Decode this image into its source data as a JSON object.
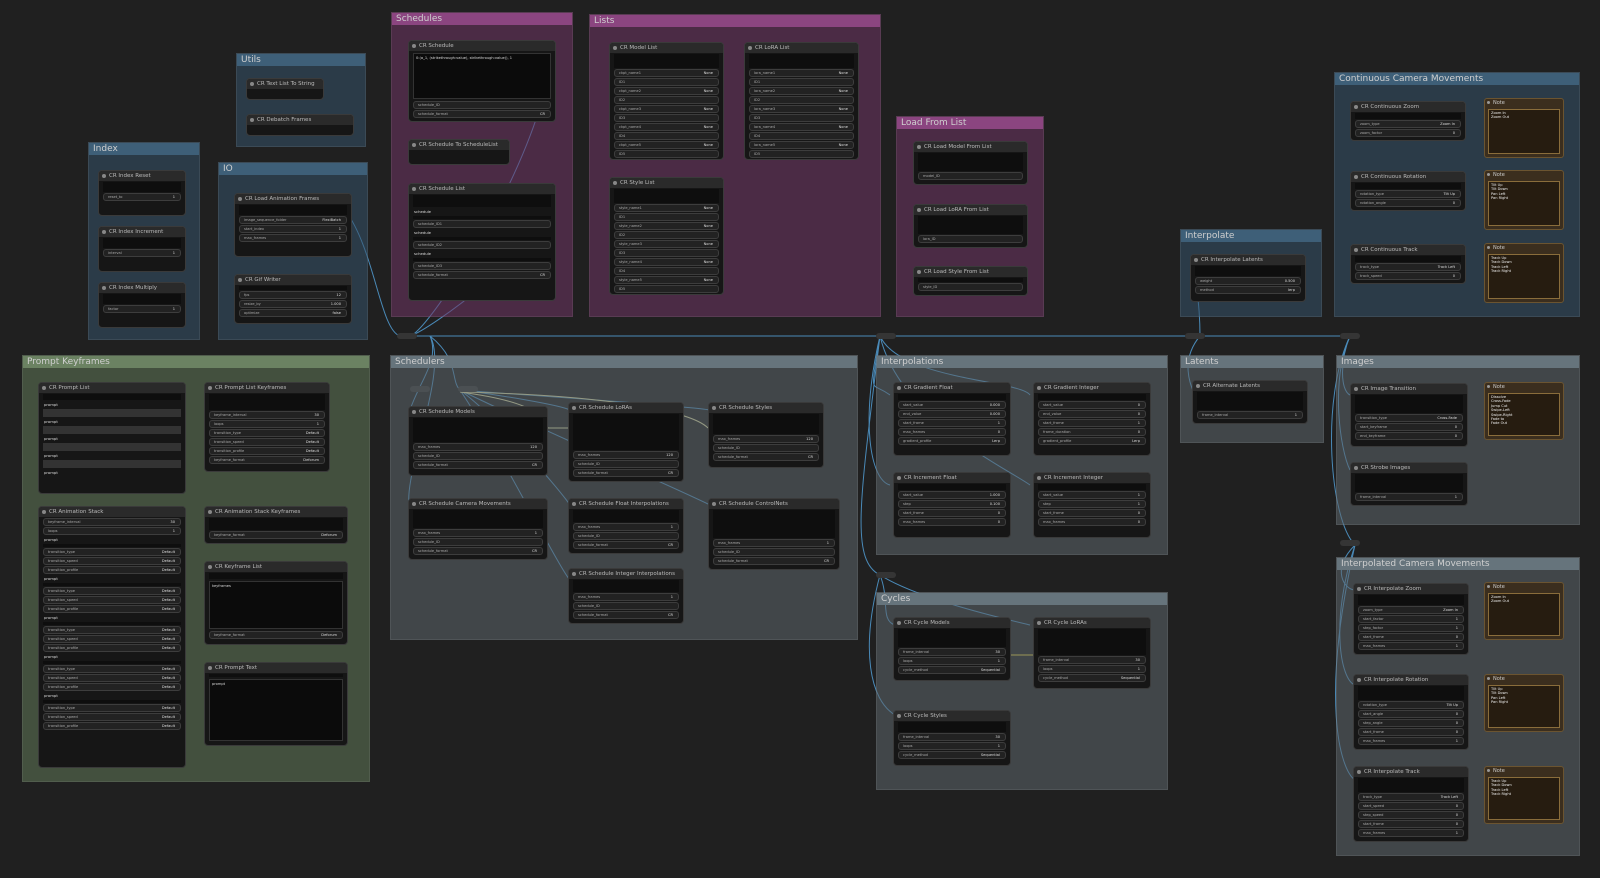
{
  "colors": {
    "canvas": "#202020",
    "purple": "#8b4580",
    "blue": "#3e5f78",
    "green": "#6b8262",
    "gray": "#66747c",
    "wire": "#4a8ab8"
  },
  "groups": {
    "index": "Index",
    "utils": "Utils",
    "io": "IO",
    "schedules": "Schedules",
    "lists": "Lists",
    "load_from_list": "Load From List",
    "interpolate": "Interpolate",
    "continuous": "Continuous Camera Movements",
    "prompt_keyframes": "Prompt Keyframes",
    "schedulers": "Schedulers",
    "interpolations": "Interpolations",
    "latents": "Latents",
    "images": "Images",
    "cycles": "Cycles",
    "interp_camera": "Interpolated Camera Movements"
  },
  "nodes": {
    "index_reset": {
      "title": "CR Index Reset",
      "w1": "reset_to",
      "v1": "1"
    },
    "index_increment": {
      "title": "CR Index Increment",
      "w1": "interval",
      "v1": "1"
    },
    "index_multiply": {
      "title": "CR Index Multiply",
      "w1": "factor",
      "v1": "1"
    },
    "text_list_to_string": {
      "title": "CR Text List To String"
    },
    "debatch_frames": {
      "title": "CR Debatch Frames"
    },
    "load_anim_frames": {
      "title": "CR Load Animation Frames",
      "w1": "image_sequence_folder",
      "v1": "FlexiBatch",
      "w2": "start_index",
      "v2": "1",
      "w3": "max_frames",
      "v3": "1"
    },
    "gif_writer": {
      "title": "CR Gif Writer",
      "w1": "fps",
      "v1": "12",
      "w2": "resize_by",
      "v2": "1.000",
      "w3": "optimize",
      "v3": "false"
    },
    "schedule": {
      "title": "CR Schedule",
      "text": "0:(a_1, (strikethrough:value), strikethrough:value)), 1",
      "w1": "schedule_ID",
      "w2": "schedule_format",
      "v2": "CR"
    },
    "schedule_to_list": {
      "title": "CR Schedule To ScheduleList"
    },
    "schedule_list": {
      "title": "CR Schedule List",
      "l1": "schedule",
      "w1": "schedule_ID1",
      "l2": "schedule",
      "w2": "schedule_ID2",
      "l3": "schedule",
      "w3": "schedule_ID3",
      "w4": "schedule_format",
      "v4": "CR"
    },
    "model_list": {
      "title": "CR Model List",
      "w1": "ckpt_name1",
      "w2": "ID1",
      "w3": "ckpt_name2",
      "w4": "ID2",
      "w5": "ckpt_name3",
      "w6": "ID3",
      "w7": "ckpt_name4",
      "w8": "ID4",
      "w9": "ckpt_name5",
      "w10": "ID5",
      "none": "None"
    },
    "lora_list": {
      "title": "CR LoRA List",
      "w1": "lora_name1",
      "w2": "ID1",
      "w3": "lora_name2",
      "w4": "ID2",
      "w5": "lora_name3",
      "w6": "ID3",
      "w7": "lora_name4",
      "w8": "ID4",
      "w9": "lora_name5",
      "w10": "ID5",
      "none": "None"
    },
    "style_list": {
      "title": "CR Style List",
      "w1": "style_name1",
      "w2": "ID1",
      "w3": "style_name2",
      "w4": "ID2",
      "w5": "style_name3",
      "w6": "ID3",
      "w7": "style_name4",
      "w8": "ID4",
      "w9": "style_name5",
      "w10": "ID5",
      "none": "None"
    },
    "load_model_from_list": {
      "title": "CR Load Model From List",
      "w1": "model_ID"
    },
    "load_lora_from_list": {
      "title": "CR Load LoRA From List",
      "w1": "lora_ID"
    },
    "load_style_from_list": {
      "title": "CR Load Style From List",
      "w1": "style_ID"
    },
    "interpolate_latents": {
      "title": "CR Interpolate Latents",
      "w1": "weight",
      "v1": "0.500",
      "w2": "method",
      "v2": "lerp"
    },
    "continuous_zoom": {
      "title": "CR Continuous Zoom",
      "w1": "zoom_type",
      "v1": "Zoom In",
      "w2": "zoom_factor",
      "v2": "0"
    },
    "continuous_rotation": {
      "title": "CR Continuous Rotation",
      "w1": "rotation_type",
      "v1": "Tilt Up",
      "w2": "rotation_angle",
      "v2": "0"
    },
    "continuous_track": {
      "title": "CR Continuous Track",
      "w1": "track_type",
      "v1": "Track Left",
      "w2": "track_speed",
      "v2": "0"
    },
    "note_zoom": {
      "title": "Note",
      "text": "Zoom In\nZoom Out"
    },
    "note_rotation": {
      "title": "Note",
      "text": "Tilt Up\nTilt Down\nPan Left\nPan Right"
    },
    "note_track": {
      "title": "Note",
      "text": "Track Up\nTrack Down\nTrack Left\nTrack Right"
    },
    "prompt_list": {
      "title": "CR Prompt List",
      "p": "prompt"
    },
    "prompt_list_keyframes": {
      "title": "CR Prompt List Keyframes",
      "w1": "keyframe_interval",
      "v1": "30",
      "w2": "loops",
      "v2": "1",
      "w3": "transition_type",
      "v3": "Default",
      "w4": "transition_speed",
      "v4": "Default",
      "w5": "transition_profile",
      "v5": "Default",
      "w6": "keyframe_format",
      "v6": "Deforum"
    },
    "animation_stack": {
      "title": "CR Animation Stack",
      "w1": "keyframe_interval",
      "v1": "30",
      "w2": "loops",
      "v2": "1",
      "p": "prompt",
      "t1": "transition_type",
      "t2": "transition_speed",
      "t3": "transition_profile",
      "def": "Default"
    },
    "animation_stack_keyframes": {
      "title": "CR Animation Stack Keyframes",
      "w1": "keyframe_format",
      "v1": "Deforum"
    },
    "keyframe_list": {
      "title": "CR Keyframe List",
      "text": "keyframes",
      "w1": "keyframe_format",
      "v1": "Deforum"
    },
    "prompt_text": {
      "title": "CR Prompt Text",
      "text": "prompt"
    },
    "schedule_models": {
      "title": "CR Schedule Models",
      "w1": "max_frames",
      "v1": "120",
      "w2": "schedule_ID",
      "w3": "schedule_format",
      "v3": "CR"
    },
    "schedule_loras": {
      "title": "CR Schedule LoRAs",
      "w1": "max_frames",
      "v1": "120",
      "w2": "schedule_ID",
      "w3": "schedule_format",
      "v3": "CR"
    },
    "schedule_styles": {
      "title": "CR Schedule Styles",
      "w1": "max_frames",
      "v1": "120",
      "w2": "schedule_ID",
      "w3": "schedule_format",
      "v3": "CR"
    },
    "schedule_camera": {
      "title": "CR Schedule Camera Movements",
      "w1": "max_frames",
      "v1": "1",
      "w2": "schedule_ID",
      "w3": "schedule_format",
      "v3": "CR"
    },
    "schedule_float": {
      "title": "CR Schedule Float Interpolations",
      "w1": "max_frames",
      "v1": "1",
      "w2": "schedule_ID",
      "w3": "schedule_format",
      "v3": "CR"
    },
    "schedule_controlnets": {
      "title": "CR Schedule ControlNets",
      "w1": "max_frames",
      "v1": "1",
      "w2": "schedule_ID",
      "w3": "schedule_format",
      "v3": "CR"
    },
    "schedule_integer": {
      "title": "CR Schedule Integer Interpolations",
      "w1": "max_frames",
      "v1": "1",
      "w2": "schedule_ID",
      "w3": "schedule_format",
      "v3": "CR"
    },
    "gradient_float": {
      "title": "CR Gradient Float",
      "w1": "start_value",
      "v1": "0.000",
      "w2": "end_value",
      "v2": "0.000",
      "w3": "start_frame",
      "v3": "1",
      "w4": "max_frames",
      "v4": "0",
      "w5": "gradient_profile",
      "v5": "Lerp"
    },
    "gradient_integer": {
      "title": "CR Gradient Integer",
      "w1": "start_value",
      "v1": "0",
      "w2": "end_value",
      "v2": "0",
      "w3": "start_frame",
      "v3": "1",
      "w4": "frame_duration",
      "v4": "0",
      "w5": "gradient_profile",
      "v5": "Lerp"
    },
    "increment_float": {
      "title": "CR Increment Float",
      "w1": "start_value",
      "v1": "1.000",
      "w2": "step",
      "v2": "0.100",
      "w3": "start_frame",
      "v3": "0",
      "w4": "max_frames",
      "v4": "0"
    },
    "increment_integer": {
      "title": "CR Increment Integer",
      "w1": "start_value",
      "v1": "1",
      "w2": "step",
      "v2": "1",
      "w3": "start_frame",
      "v3": "0",
      "w4": "max_frames",
      "v4": "0"
    },
    "alternate_latents": {
      "title": "CR Alternate Latents",
      "w1": "frame_interval",
      "v1": "1"
    },
    "image_transition": {
      "title": "CR Image Transition",
      "w1": "transition_type",
      "v1": "Cross-Fade",
      "w2": "start_keyframe",
      "v2": "0",
      "w3": "end_keyframe",
      "v3": "0"
    },
    "strobe_images": {
      "title": "CR Strobe Images",
      "w1": "frame_interval",
      "v1": "1"
    },
    "note_transition": {
      "title": "Note",
      "text": "Dissolve\nCross-Fade\nJump Cut\nSwipe-Left\nSwipe-Right\nFade to\nFade Out"
    },
    "cycle_models": {
      "title": "CR Cycle Models",
      "w1": "frame_interval",
      "v1": "30",
      "w2": "loops",
      "v2": "1",
      "w3": "cycle_method",
      "v3": "Sequential"
    },
    "cycle_loras": {
      "title": "CR Cycle LoRAs",
      "w1": "frame_interval",
      "v1": "30",
      "w2": "loops",
      "v2": "1",
      "w3": "cycle_method",
      "v3": "Sequential"
    },
    "cycle_styles": {
      "title": "CR Cycle Styles",
      "w1": "frame_interval",
      "v1": "30",
      "w2": "loops",
      "v2": "1",
      "w3": "cycle_method",
      "v3": "Sequential"
    },
    "interpolate_zoom": {
      "title": "CR Interpolate Zoom",
      "w1": "zoom_type",
      "v1": "Zoom In",
      "w2": "start_factor",
      "v2": "1",
      "w3": "step_factor",
      "v3": "1",
      "w4": "start_frame",
      "v4": "0",
      "w5": "max_frames",
      "v5": "1"
    },
    "interpolate_rotation": {
      "title": "CR Interpolate Rotation",
      "w1": "rotation_type",
      "v1": "Tilt Up",
      "w2": "start_angle",
      "v2": "0",
      "w3": "step_angle",
      "v3": "0",
      "w4": "start_frame",
      "v4": "0",
      "w5": "max_frames",
      "v5": "1"
    },
    "interpolate_track": {
      "title": "CR Interpolate Track",
      "w1": "track_type",
      "v1": "Track Left",
      "w2": "start_speed",
      "v2": "0",
      "w3": "step_speed",
      "v3": "0",
      "w4": "start_frame",
      "v4": "0",
      "w5": "max_frames",
      "v5": "1"
    },
    "note_izoom": {
      "title": "Note",
      "text": "Zoom In\nZoom Out"
    },
    "note_irotation": {
      "title": "Note",
      "text": "Tilt Up\nTilt Down\nPan Left\nPan Right"
    },
    "note_itrack": {
      "title": "Note",
      "text": "Track Up\nTrack Down\nTrack Left\nTrack Right"
    }
  }
}
